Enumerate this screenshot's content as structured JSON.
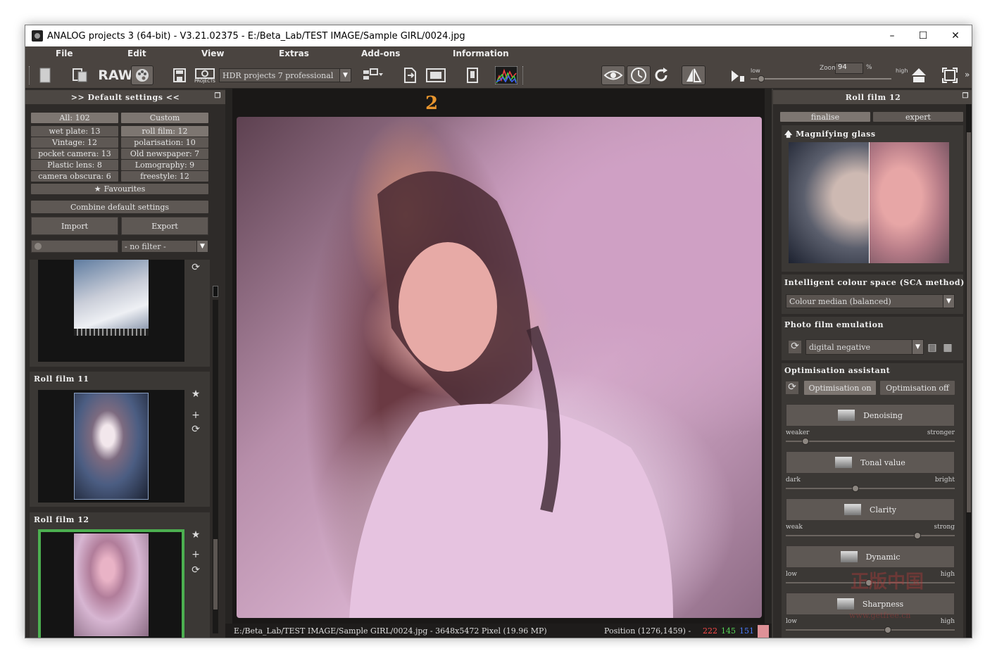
{
  "window": {
    "title": "ANALOG projects 3 (64-bit) - V3.21.02375 - E:/Beta_Lab/TEST IMAGE/Sample GIRL/0024.jpg",
    "controls": {
      "minimize": "–",
      "maximize": "☐",
      "close": "✕"
    }
  },
  "menu": [
    "File",
    "Edit",
    "View",
    "Extras",
    "Add-ons",
    "Information"
  ],
  "toolbar": {
    "raw_label": "RAW",
    "projects_label": "PROJECTS",
    "hdr_select": "HDR projects 7 professional",
    "zoom_label": "Zoom",
    "zoom_value": "94",
    "zoom_unit": "%",
    "low_label": "low",
    "high_label": "high",
    "zoom_level": 0.05,
    "more": "»"
  },
  "left_panel": {
    "header": ">> Default settings <<",
    "categories": [
      [
        "All: 102",
        "Custom"
      ],
      [
        "wet plate: 13",
        "roll film: 12"
      ],
      [
        "Vintage: 12",
        "polarisation: 10"
      ],
      [
        "pocket camera: 13",
        "Old newspaper: 7"
      ],
      [
        "Plastic lens: 8",
        "Lomography: 9"
      ],
      [
        "camera obscura: 6",
        "freestyle: 12"
      ]
    ],
    "favourites": "Favourites",
    "combine": "Combine default settings",
    "import": "Import",
    "export": "Export",
    "filter": "- no filter -",
    "rolls": [
      {
        "title": ""
      },
      {
        "title": "Roll film 11"
      },
      {
        "title": "Roll film 12"
      }
    ]
  },
  "image": {
    "frame_number": "2",
    "path_info": "E:/Beta_Lab/TEST IMAGE/Sample GIRL/0024.jpg - 3648x5472 Pixel (19.96 MP)",
    "position": "Position (1276,1459) -",
    "r": "222",
    "g": "145",
    "b": "151",
    "swatch": "#de9197"
  },
  "right_panel": {
    "header": "Roll film 12",
    "tabs": [
      "finalise",
      "expert"
    ],
    "magnifier": "Magnifying glass",
    "colour_space_title": "Intelligent colour space (SCA method)",
    "colour_space_value": "Colour median (balanced)",
    "film_title": "Photo film emulation",
    "film_value": "digital negative",
    "assistant_title": "Optimisation assistant",
    "opt_on": "Optimisation on",
    "opt_off": "Optimisation off",
    "controls": [
      {
        "label": "Denoising",
        "left": "weaker",
        "right": "stronger",
        "value": 0.1
      },
      {
        "label": "Tonal value",
        "left": "dark",
        "right": "bright",
        "value": 0.41
      },
      {
        "label": "Clarity",
        "left": "weak",
        "right": "strong",
        "value": 0.79
      },
      {
        "label": "Dynamic",
        "left": "low",
        "right": "high",
        "value": 0.49
      },
      {
        "label": "Sharpness",
        "left": "low",
        "right": "high",
        "value": 0.61
      }
    ],
    "watermark_cn": "正版中国",
    "watermark_url": "www.getfree.cn"
  },
  "colors": {
    "bg_dark": "#2e2b29",
    "toolbar": "#4a4440",
    "selected_border": "#4caf50",
    "r": "#ff4a4a",
    "g": "#56d256",
    "b": "#4a7cff"
  }
}
